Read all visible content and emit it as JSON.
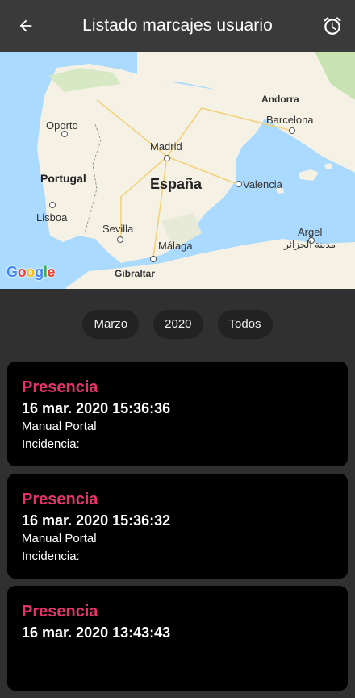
{
  "appbar": {
    "title": "Listado marcajes usuario",
    "back_icon": "arrow-back-icon",
    "alarm_icon": "alarm-clock-icon"
  },
  "map": {
    "labels": {
      "andorra": "Andorra",
      "oporto": "Oporto",
      "barcelona": "Barcelona",
      "madrid": "Madrid",
      "portugal": "Portugal",
      "espana": "España",
      "valencia": "Valencia",
      "lisboa": "Lisboa",
      "sevilla": "Sevilla",
      "argel": "Argel",
      "argel_ar": "مدينة الجزائر",
      "malaga": "Málaga",
      "gibraltar": "Gibraltar"
    },
    "google": [
      "G",
      "o",
      "o",
      "g",
      "l",
      "e"
    ],
    "colors": {
      "sea": "#aadaff",
      "land": "#f5f1e4",
      "green": "#c8e2b2"
    }
  },
  "filters": {
    "month": "Marzo",
    "year": "2020",
    "type": "Todos"
  },
  "records": [
    {
      "type": "Presencia",
      "datetime": "16 mar. 2020 15:36:36",
      "source": "Manual Portal",
      "incidence": "Incidencia:"
    },
    {
      "type": "Presencia",
      "datetime": "16 mar. 2020 15:36:32",
      "source": "Manual Portal",
      "incidence": "Incidencia:"
    },
    {
      "type": "Presencia",
      "datetime": "16 mar. 2020 13:43:43",
      "source": "",
      "incidence": ""
    }
  ],
  "colors": {
    "background": "#303030",
    "appbar": "#3a3a3a",
    "card": "#000000",
    "accent": "#e5336a"
  }
}
